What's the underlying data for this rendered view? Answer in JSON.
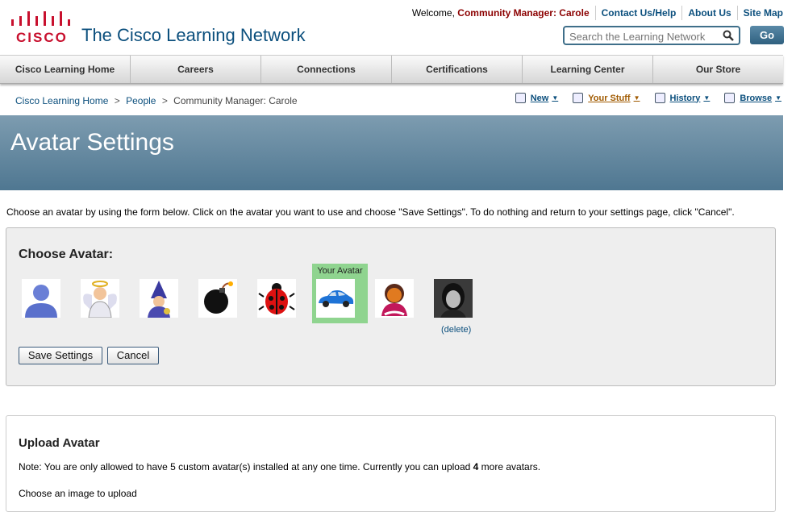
{
  "header": {
    "logo_text": "CISCO",
    "site_title": "The Cisco Learning Network",
    "welcome_prefix": "Welcome, ",
    "welcome_user": "Community Manager: Carole",
    "links": [
      "Contact Us/Help",
      "About Us",
      "Site Map"
    ],
    "search_placeholder": "Search the Learning Network",
    "go_label": "Go"
  },
  "nav": [
    "Cisco Learning Home",
    "Careers",
    "Connections",
    "Certifications",
    "Learning Center",
    "Our Store"
  ],
  "breadcrumb": {
    "items": [
      "Cisco Learning Home",
      "People"
    ],
    "separator": ">",
    "current": "Community Manager: Carole"
  },
  "actions": [
    {
      "label": "New",
      "icon": "document-new-icon"
    },
    {
      "label": "Your Stuff",
      "icon": "your-stuff-icon"
    },
    {
      "label": "History",
      "icon": "history-icon"
    },
    {
      "label": "Browse",
      "icon": "browse-icon"
    }
  ],
  "page_title": "Avatar Settings",
  "intro": "Choose an avatar by using the form below. Click on the avatar you want to use and choose \"Save Settings\".  To do nothing and return to your settings page, click \"Cancel\".",
  "choose": {
    "title": "Choose Avatar:",
    "selected_label": "Your Avatar",
    "avatars": [
      "person-avatar-icon",
      "angel-avatar-icon",
      "wizard-avatar-icon",
      "bomb-avatar-icon",
      "ladybug-avatar-icon",
      "car-avatar-icon",
      "ninja-avatar-icon",
      "photo-avatar"
    ],
    "selected_index": 5,
    "delete_label": "(delete)",
    "save_label": "Save Settings",
    "cancel_label": "Cancel"
  },
  "upload": {
    "title": "Upload Avatar",
    "note_prefix": "Note: You are only allowed to have 5 custom avatar(s) installed at any one time. Currently you can upload ",
    "note_count": "4",
    "note_suffix": " more avatars.",
    "choose_label": "Choose an image to upload"
  },
  "colors": {
    "brand_red": "#c8102e",
    "link_blue": "#0b4f7d",
    "banner": "#5f8399",
    "selected_bg": "#8fd48f"
  }
}
